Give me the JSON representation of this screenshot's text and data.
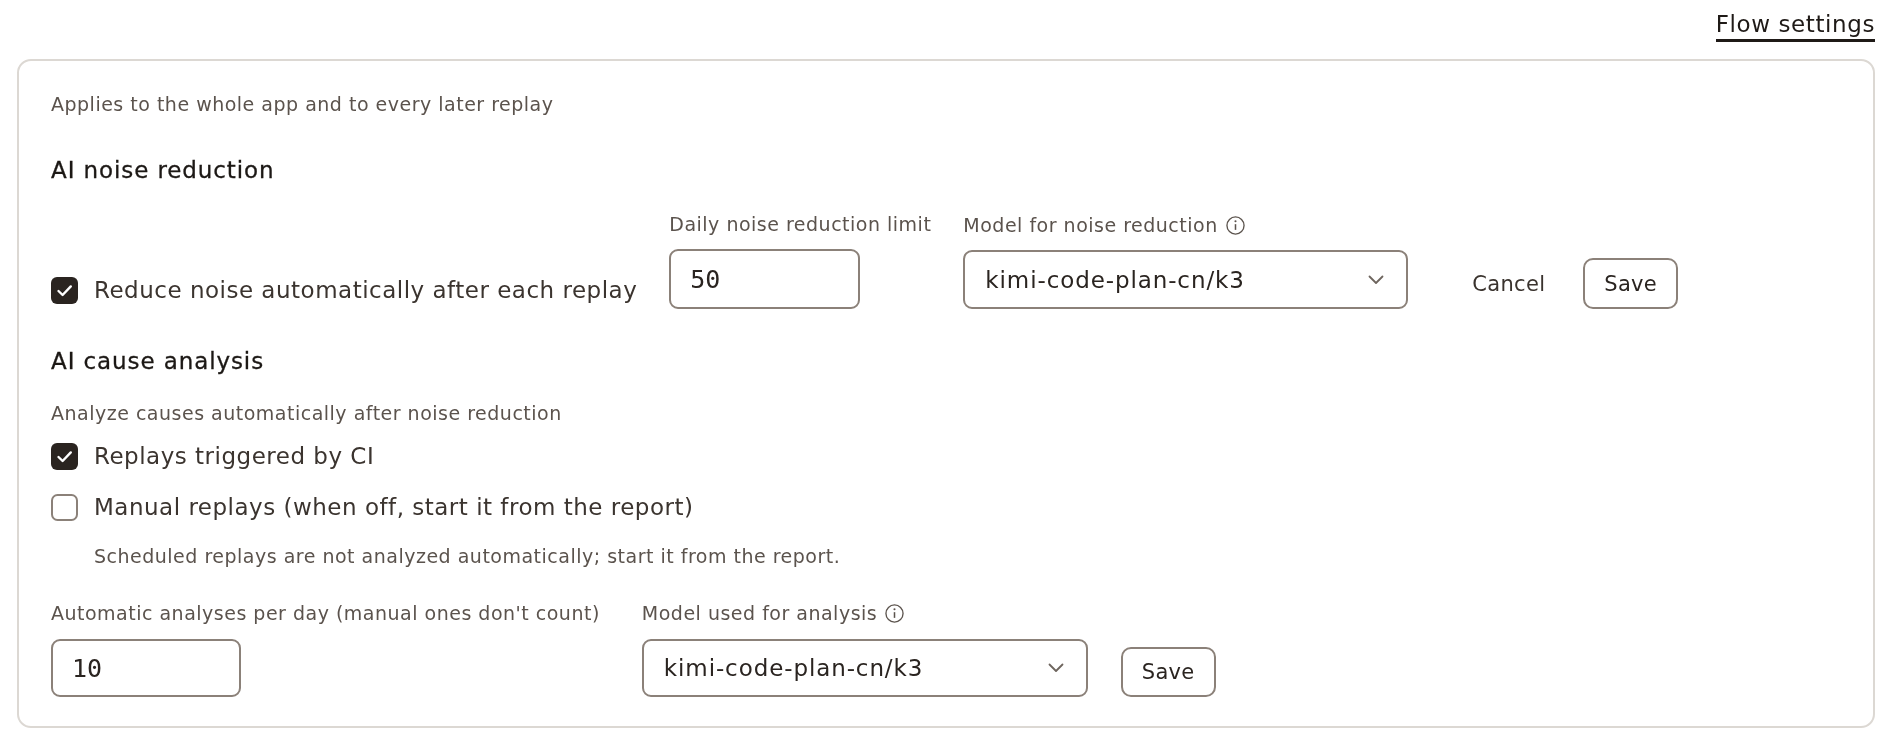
{
  "tabs": [
    {
      "label": "Flow settings",
      "selected": true
    }
  ],
  "settings_card": {
    "description": "Applies to the whole app and to every later replay",
    "noise_reduction": {
      "title": "AI noise reduction",
      "auto_reduce": {
        "label": "Reduce noise automatically after each replay",
        "checked": true
      },
      "daily_limit": {
        "label": "Daily noise reduction limit",
        "value": "50"
      },
      "model": {
        "label": "Model for noise reduction",
        "value": "kimi-code-plan-cn/k3"
      },
      "buttons": [
        {
          "label": "Cancel",
          "kind": "cancel"
        },
        {
          "label": "Save",
          "kind": "save"
        }
      ]
    },
    "cause_analysis": {
      "title": "AI cause analysis",
      "subtitle": "Analyze causes automatically after noise reduction",
      "options": [
        {
          "label": "Replays triggered by CI",
          "checked": true
        },
        {
          "label": "Manual replays (when off, start it from the report)",
          "checked": false
        }
      ],
      "note": "Scheduled replays are not analyzed automatically; start it from the report.",
      "daily_limit": {
        "label": "Automatic analyses per day (manual ones don't count)",
        "value": "10"
      },
      "model": {
        "label": "Model used for analysis",
        "value": "kimi-code-plan-cn/k3"
      },
      "buttons": [
        {
          "label": "Save",
          "kind": "save"
        }
      ]
    }
  }
}
